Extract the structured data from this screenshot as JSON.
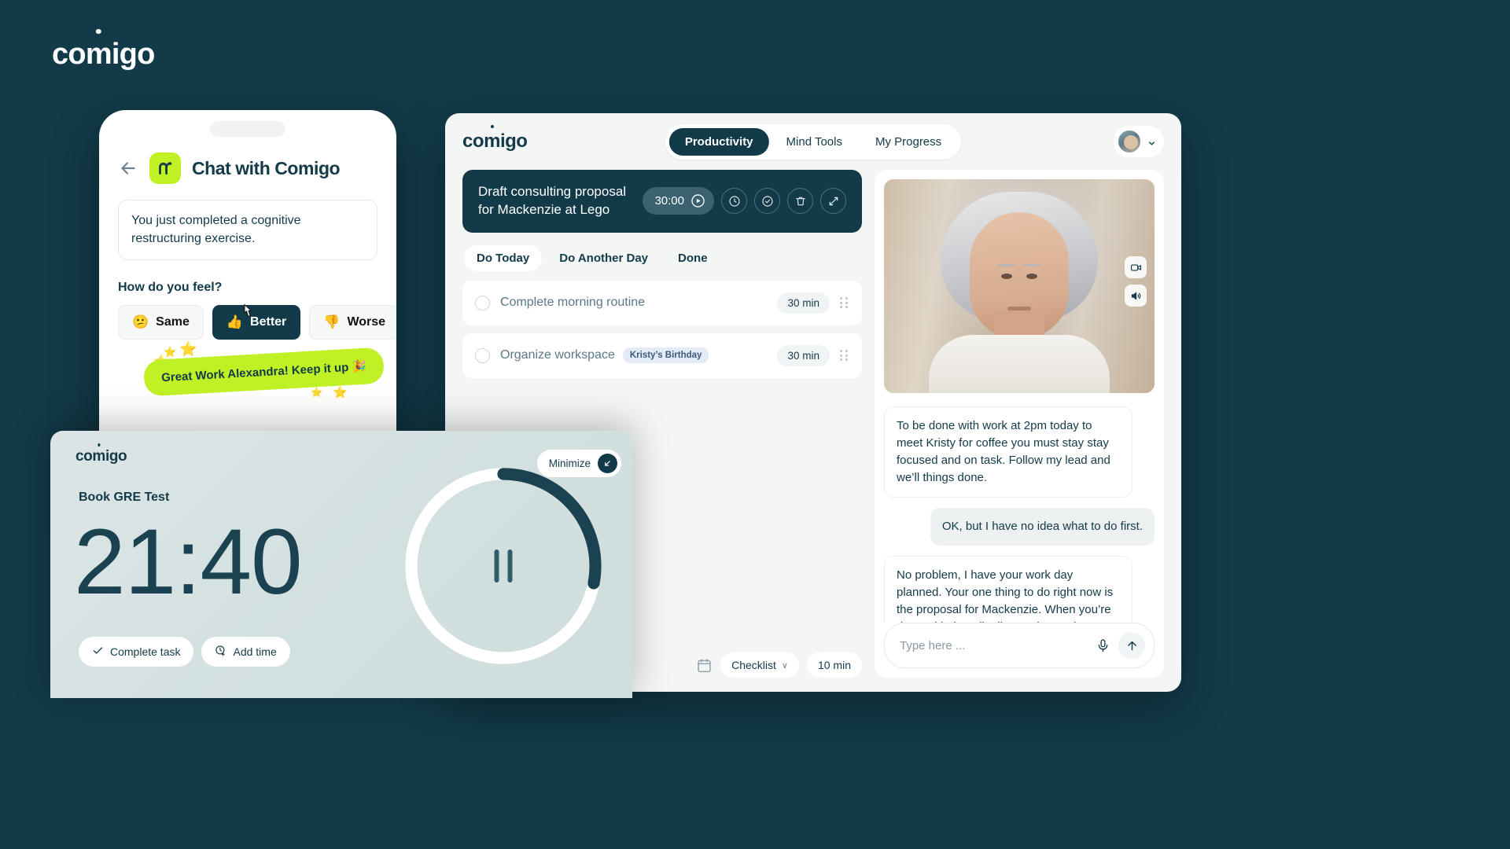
{
  "brand": {
    "name": "comigo"
  },
  "phone": {
    "title": "Chat with Comigo",
    "back_icon": "back-arrow-icon",
    "prompt": "You just completed a cognitive restructuring exercise.",
    "feel_label": "How do you feel?",
    "feel_options": [
      {
        "emoji": "😕",
        "label": "Same",
        "active": false
      },
      {
        "emoji": "👍",
        "label": "Better",
        "active": true
      },
      {
        "emoji": "👎",
        "label": "Worse",
        "active": false
      }
    ],
    "toast": "Great Work Alexandra! Keep it up 🎉"
  },
  "dashboard": {
    "brand": "comigo",
    "tabs": [
      {
        "label": "Productivity",
        "active": true
      },
      {
        "label": "Mind Tools",
        "active": false
      },
      {
        "label": "My Progress",
        "active": false
      }
    ],
    "task_banner": {
      "title": "Draft consulting proposal for Mackenzie at Lego",
      "timer": "30:00",
      "actions": [
        "play-icon",
        "history-clock-icon",
        "check-circle-icon",
        "trash-icon",
        "expand-icon"
      ]
    },
    "filters": [
      {
        "label": "Do Today",
        "active": true
      },
      {
        "label": "Do Another Day",
        "active": false
      },
      {
        "label": "Done",
        "active": false
      }
    ],
    "tasks": [
      {
        "name": "Complete morning routine",
        "tag": "",
        "duration": "30 min"
      },
      {
        "name": "Organize workspace",
        "tag": "Kristy’s Birthday",
        "duration": "30 min"
      }
    ],
    "footer": {
      "checklist_label": "Checklist",
      "checklist_caret": "∨",
      "duration": "10 min"
    }
  },
  "chat": {
    "messages": [
      {
        "from": "bot",
        "text": "To be done with work at 2pm today to meet Kristy for coffee you must stay stay focused and on task. Follow my lead and we’ll things done."
      },
      {
        "from": "me",
        "text": "OK, but I have no idea what to do first."
      },
      {
        "from": "bot",
        "text": "No problem, I have your work day planned. Your one thing to do right now is the proposal for Mackenzie. When you’re done with that I’ll tell you what to do next!"
      }
    ],
    "input_placeholder": "Type here ..."
  },
  "focus": {
    "brand": "comigo",
    "minimize_label": "Minimize",
    "task": "Book GRE Test",
    "time": "21:40",
    "buttons": [
      {
        "icon": "check-icon",
        "label": "Complete task"
      },
      {
        "icon": "clock-plus-icon",
        "label": "Add time"
      }
    ],
    "progress_percent": 28
  },
  "colors": {
    "background": "#123A48",
    "accent_green": "#BFF125",
    "surface": "#f4f6f6",
    "tag_blue": "#e3ebf8"
  }
}
